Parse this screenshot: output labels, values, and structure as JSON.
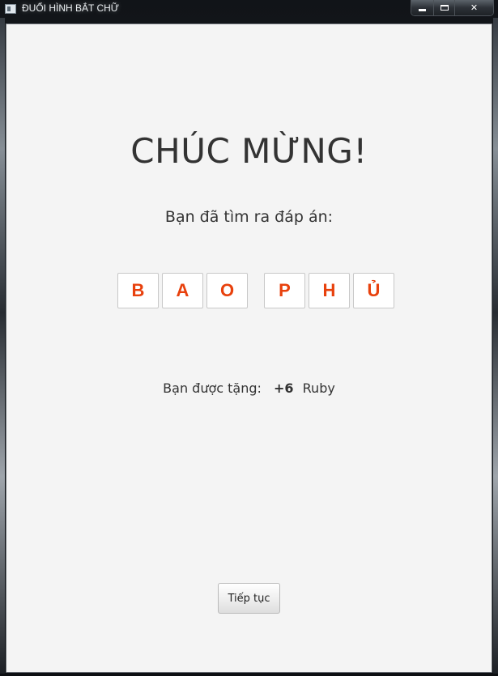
{
  "window": {
    "title": "ĐUỔI HÌNH BẮT CHỮ",
    "app_icon": "window-app-icon",
    "controls": {
      "minimize_icon": "minimize-icon",
      "maximize_icon": "maximize-icon",
      "close_label": "✕"
    }
  },
  "main": {
    "heading": "CHÚC MỪNG!",
    "subtitle": "Bạn đã tìm ra đáp án:",
    "answer": {
      "words": [
        [
          "B",
          "A",
          "O"
        ],
        [
          "P",
          "H",
          "Ủ"
        ]
      ]
    },
    "reward": {
      "label": "Bạn được tặng:",
      "amount": "+6",
      "unit": "Ruby"
    },
    "continue_label": "Tiếp tục"
  },
  "colors": {
    "background": "#f4f4f4",
    "tile_letter": "#e8410d",
    "text": "#333333"
  }
}
